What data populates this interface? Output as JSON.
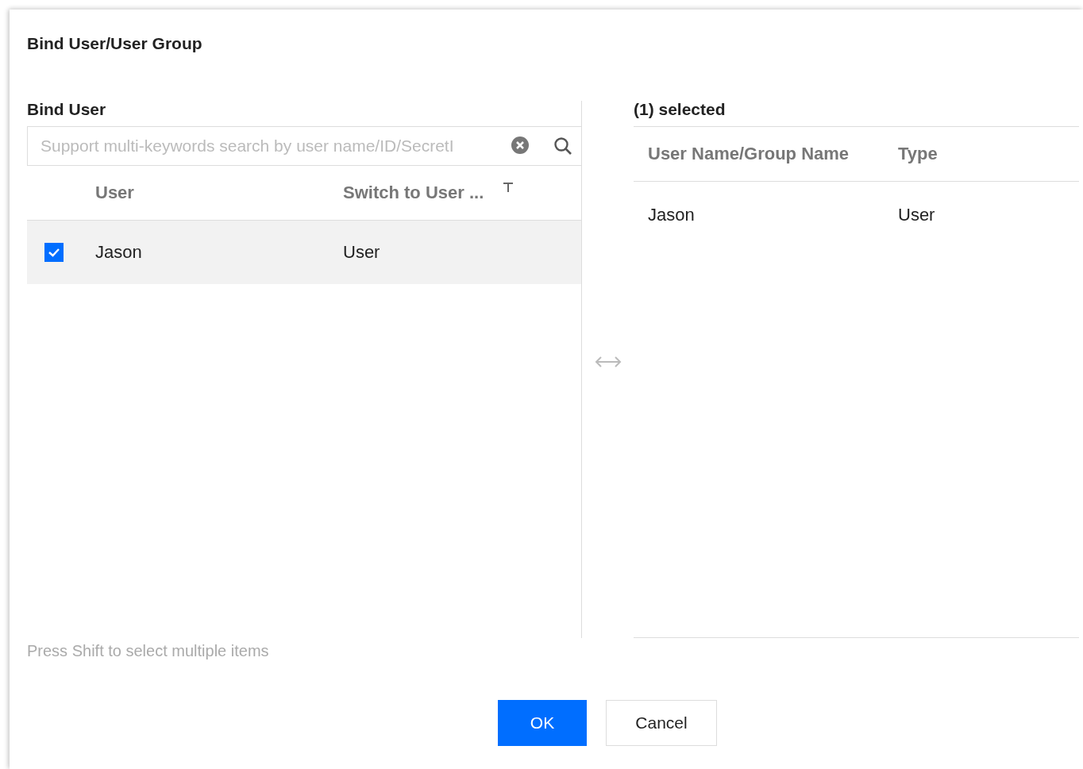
{
  "dialog": {
    "title": "Bind User/User Group"
  },
  "left_panel": {
    "title": "Bind User",
    "search": {
      "placeholder": "Support multi-keywords search by user name/ID/SecretI"
    },
    "columns": [
      "User",
      "Switch to User ..."
    ],
    "rows": [
      {
        "selected": true,
        "cells": [
          "Jason",
          "User"
        ]
      }
    ]
  },
  "right_panel": {
    "title": "(1) selected",
    "columns": [
      "User Name/Group Name",
      "Type"
    ],
    "rows": [
      {
        "cells": [
          "Jason",
          "User"
        ]
      }
    ]
  },
  "hint": "Press Shift to select multiple items",
  "buttons": [
    {
      "label": "OK",
      "kind": "primary"
    },
    {
      "label": "Cancel",
      "kind": "secondary"
    }
  ]
}
